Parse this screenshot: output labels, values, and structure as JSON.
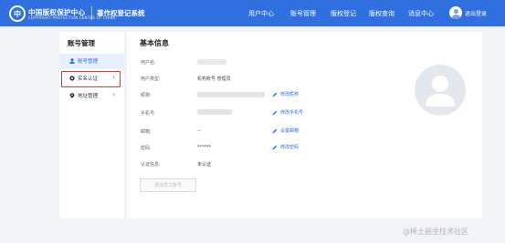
{
  "header": {
    "logo_glyph": "中",
    "brand_name": "中国版权保护中心",
    "brand_sub": "COPYRIGHT PROTECTION CENTER OF CHINA",
    "system_name": "著作权登记系统",
    "nav": [
      "用户中心",
      "账号管理",
      "版权登记",
      "版权查询",
      "消息中心"
    ],
    "user_name": "退出登录"
  },
  "sidebar": {
    "title": "账号管理",
    "items": [
      {
        "label": "账号管理",
        "icon": "user-icon",
        "active": true
      },
      {
        "label": "实名认证",
        "icon": "verify-icon",
        "active": false
      },
      {
        "label": "地址管理",
        "icon": "location-icon",
        "active": false
      }
    ],
    "chevron": "›"
  },
  "main": {
    "title": "基本信息",
    "fields": {
      "username": {
        "label": "用户名:",
        "value": ""
      },
      "user_type": {
        "label": "用户类型:",
        "value": "机构账号 管理员"
      },
      "nickname": {
        "label": "昵称:",
        "value": "",
        "action": "修改昵称"
      },
      "phone": {
        "label": "手机号:",
        "value": "",
        "action": "修改手机号"
      },
      "email": {
        "label": "邮箱:",
        "value": "--",
        "action": "设置邮箱"
      },
      "password": {
        "label": "密码:",
        "value": "******",
        "action": "修改密码"
      },
      "verify_status": {
        "label": "认证信息:",
        "value": "未认证"
      }
    },
    "add_staff_button": "添加员工账号"
  },
  "watermark": "@稀土掘金技术社区",
  "colors": {
    "primary": "#2f6fe0",
    "highlight": "#e53935",
    "page_bg": "#f2f3f5"
  }
}
